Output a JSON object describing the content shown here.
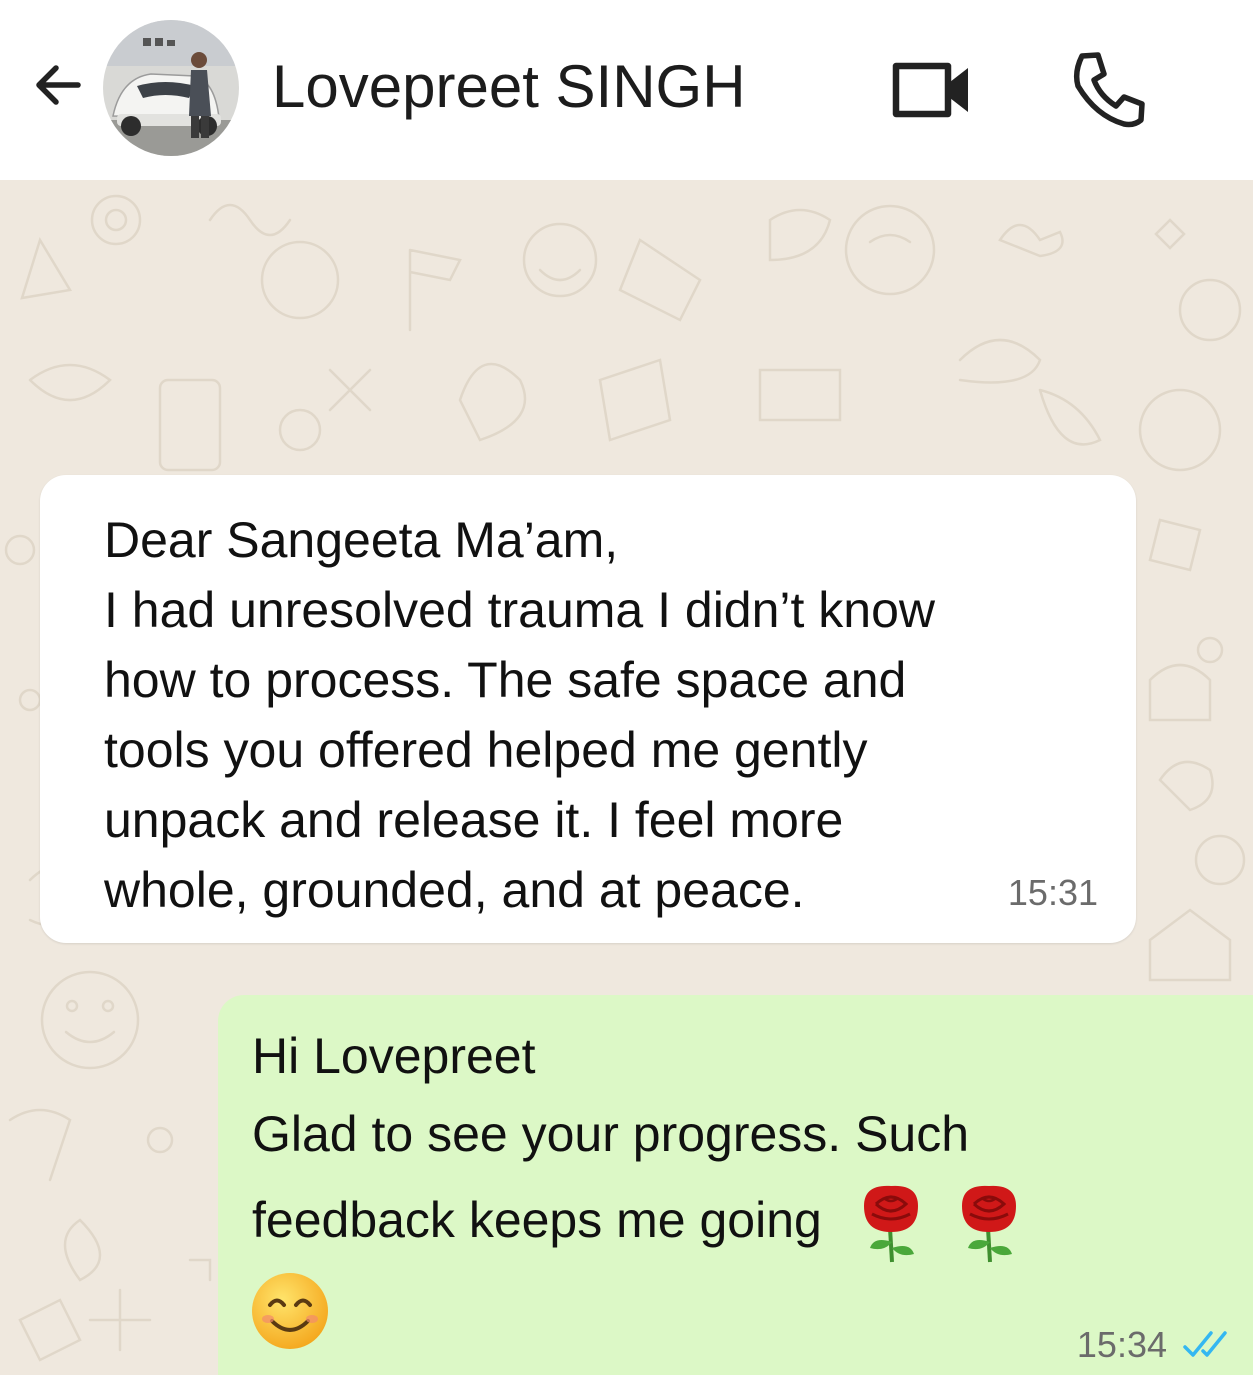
{
  "header": {
    "contact_name": "Lovepreet SINGH",
    "icons": {
      "back": "arrow-left-icon",
      "avatar": "contact-avatar",
      "video": "video-camera-icon",
      "call": "phone-icon"
    }
  },
  "messages": [
    {
      "direction": "incoming",
      "lines": [
        "Dear Sangeeta Ma’am,",
        "I had unresolved trauma I didn’t know",
        "how to process. The safe space and",
        "tools you offered helped me gently",
        "unpack and release it. I feel more",
        "whole, grounded, and at peace."
      ],
      "time": "15:31"
    },
    {
      "direction": "outgoing",
      "lines": [
        "Hi Lovepreet",
        "Glad to see your progress. Such",
        "feedback   keeps me going"
      ],
      "emojis": [
        "rose-emoji",
        "rose-emoji",
        "smiling-face-emoji"
      ],
      "time": "15:34",
      "status": "read"
    }
  ],
  "colors": {
    "header_bg": "#ffffff",
    "chat_bg": "#efe8de",
    "incoming_bubble": "#ffffff",
    "outgoing_bubble": "#dcf8c6",
    "read_tick": "#34b7f1"
  }
}
